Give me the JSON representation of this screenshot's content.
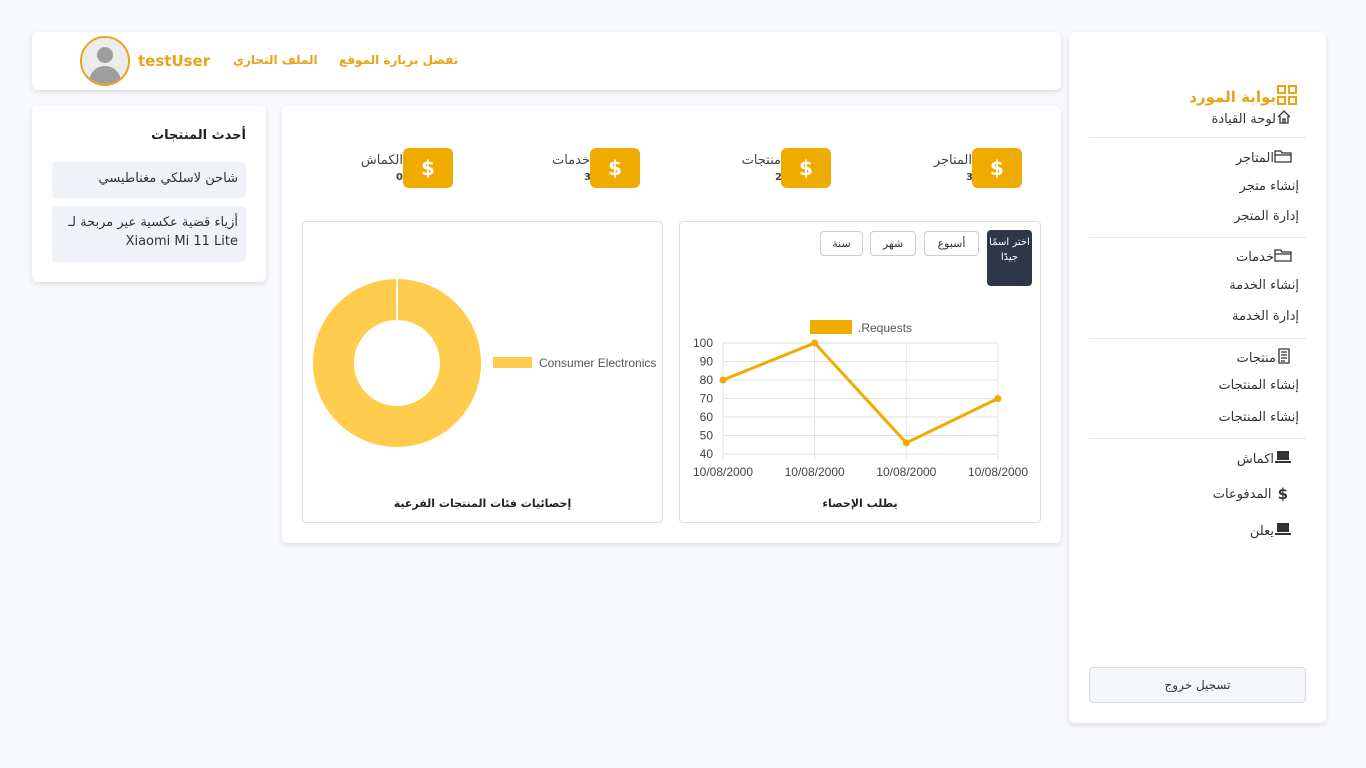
{
  "sidebar": {
    "brand": "بوابة المورد",
    "items": [
      {
        "label": "لوحة القيادة",
        "icon": "home-icon"
      },
      {
        "label": "المتاجر",
        "icon": "folder-icon"
      },
      {
        "label": "إنشاء متجر",
        "icon": ""
      },
      {
        "label": "إدارة المتجر",
        "icon": ""
      },
      {
        "label": "خدمات",
        "icon": "folder-icon"
      },
      {
        "label": "إنشاء الخدمة",
        "icon": ""
      },
      {
        "label": "إدارة الخدمة",
        "icon": ""
      },
      {
        "label": "منتجات",
        "icon": "receipt-icon"
      },
      {
        "label": "إنشاء المنتجات",
        "icon": ""
      },
      {
        "label": "إنشاء المنتجات",
        "icon": ""
      },
      {
        "label": "اكماش",
        "icon": "laptop-icon"
      },
      {
        "label": "المدفوعات",
        "icon": "dollar-icon"
      },
      {
        "label": "يعلن",
        "icon": "laptop-icon"
      }
    ],
    "logout": "تسجيل خروج"
  },
  "header": {
    "username": "testUser",
    "links": [
      "تفضل بزيارة الموقع",
      "الملف التجاري"
    ]
  },
  "latest": {
    "title": "أحدث المنتجات",
    "products": [
      "شاحن لاسلكي مغناطيسي",
      "أزياء قضية عكسية عير مربحة لـ Xiaomi Mi 11 Lite"
    ]
  },
  "stats": [
    {
      "label": "المتاجر",
      "value": "3",
      "symbol": "$"
    },
    {
      "label": "منتجات",
      "value": "2",
      "symbol": "$"
    },
    {
      "label": "خدمات",
      "value": "3",
      "symbol": "$"
    },
    {
      "label": "الكماش",
      "value": "0",
      "symbol": "$"
    }
  ],
  "line_panel": {
    "tabs": [
      "أسبوع",
      "شهر",
      "سنة"
    ],
    "pick_label": "اختر اسمًا جيدًا",
    "caption": "يطلب الإحصاء"
  },
  "donut_panel": {
    "caption": "إحصائيات فئات المنتجات الفرعية"
  },
  "colors": {
    "accent": "#f0ab00",
    "donut": "#ffcc4d",
    "dark": "#2d3748"
  },
  "chart_data": [
    {
      "type": "line",
      "x": [
        "10/08/2000",
        "10/08/2000",
        "10/08/2000",
        "10/08/2000"
      ],
      "series": [
        {
          "name": ".Requests",
          "values": [
            80,
            100,
            46,
            70
          ]
        }
      ],
      "ylim": [
        40,
        100
      ],
      "yticks": [
        40,
        50,
        60,
        70,
        80,
        90,
        100
      ],
      "grid": true,
      "legend": "top"
    },
    {
      "type": "pie",
      "categories": [
        "Consumer Electronics"
      ],
      "values": [
        100
      ],
      "legend": "right"
    }
  ]
}
